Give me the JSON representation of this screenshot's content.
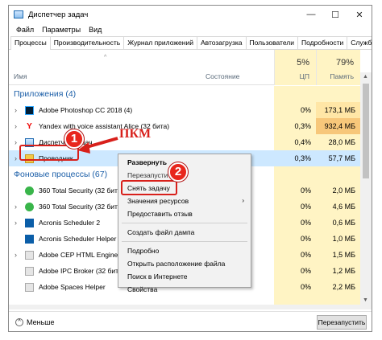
{
  "window": {
    "title": "Диспетчер задач",
    "controls": {
      "minimize": "—",
      "maximize": "☐",
      "close": "✕"
    }
  },
  "menu": [
    "Файл",
    "Параметры",
    "Вид"
  ],
  "tabs": [
    "Процессы",
    "Производительность",
    "Журнал приложений",
    "Автозагрузка",
    "Пользователи",
    "Подробности",
    "Службы"
  ],
  "columns": {
    "sort_indicator": "^",
    "name": "Имя",
    "status": "Состояние",
    "cpu_percent": "5%",
    "cpu_label": "ЦП",
    "mem_percent": "79%",
    "mem_label": "Память"
  },
  "groups": {
    "apps": "Приложения (4)",
    "background": "Фоновые процессы (67)"
  },
  "rows": [
    {
      "name": "Adobe Photoshop CC 2018 (4)",
      "cpu": "0%",
      "mem": "173,1 МБ"
    },
    {
      "name": "Yandex with voice assistant Alice (32 бита)",
      "cpu": "0,3%",
      "mem": "932,4 МБ"
    },
    {
      "name": "Диспетчер задач",
      "cpu": "0,4%",
      "mem": "28,0 МБ"
    },
    {
      "name": "Проводник",
      "cpu": "0,3%",
      "mem": "57,7 МБ"
    },
    {
      "name": "360 Total Security (32 бита)",
      "cpu": "0%",
      "mem": "2,0 МБ"
    },
    {
      "name": "360 Total Security (32 бита)",
      "cpu": "0%",
      "mem": "4,6 МБ"
    },
    {
      "name": "Acronis Scheduler 2",
      "cpu": "0%",
      "mem": "0,6 МБ"
    },
    {
      "name": "Acronis Scheduler Helper",
      "cpu": "0%",
      "mem": "1,0 МБ"
    },
    {
      "name": "Adobe CEP HTML Engine",
      "cpu": "0%",
      "mem": "1,5 МБ"
    },
    {
      "name": "Adobe IPC Broker (32 бита)",
      "cpu": "0%",
      "mem": "1,2 МБ"
    },
    {
      "name": "Adobe Spaces Helper",
      "cpu": "0%",
      "mem": "2,2 МБ"
    },
    {
      "name": "",
      "cpu": "",
      "mem": ""
    }
  ],
  "context_menu": {
    "expand": "Развернуть",
    "restart": "Перезапустить",
    "end_task": "Снять задачу",
    "resource_values": "Значения ресурсов",
    "submenu_arrow": "›",
    "feedback": "Предоставить отзыв",
    "dump": "Создать файл дампа",
    "details": "Подробно",
    "open_location": "Открыть расположение файла",
    "search_online": "Поиск в Интернете",
    "properties": "Свойства"
  },
  "annotations": {
    "badge1": "1",
    "badge2": "2",
    "pkm": "ПКМ"
  },
  "footer": {
    "less": "Меньше",
    "less_icon": "^",
    "restart_button": "Перезапустить"
  },
  "colors": {
    "accent_red": "#d8201b",
    "group_blue": "#1c5fa8",
    "column_highlight": "#fff4c4",
    "selection": "#cde8ff"
  }
}
